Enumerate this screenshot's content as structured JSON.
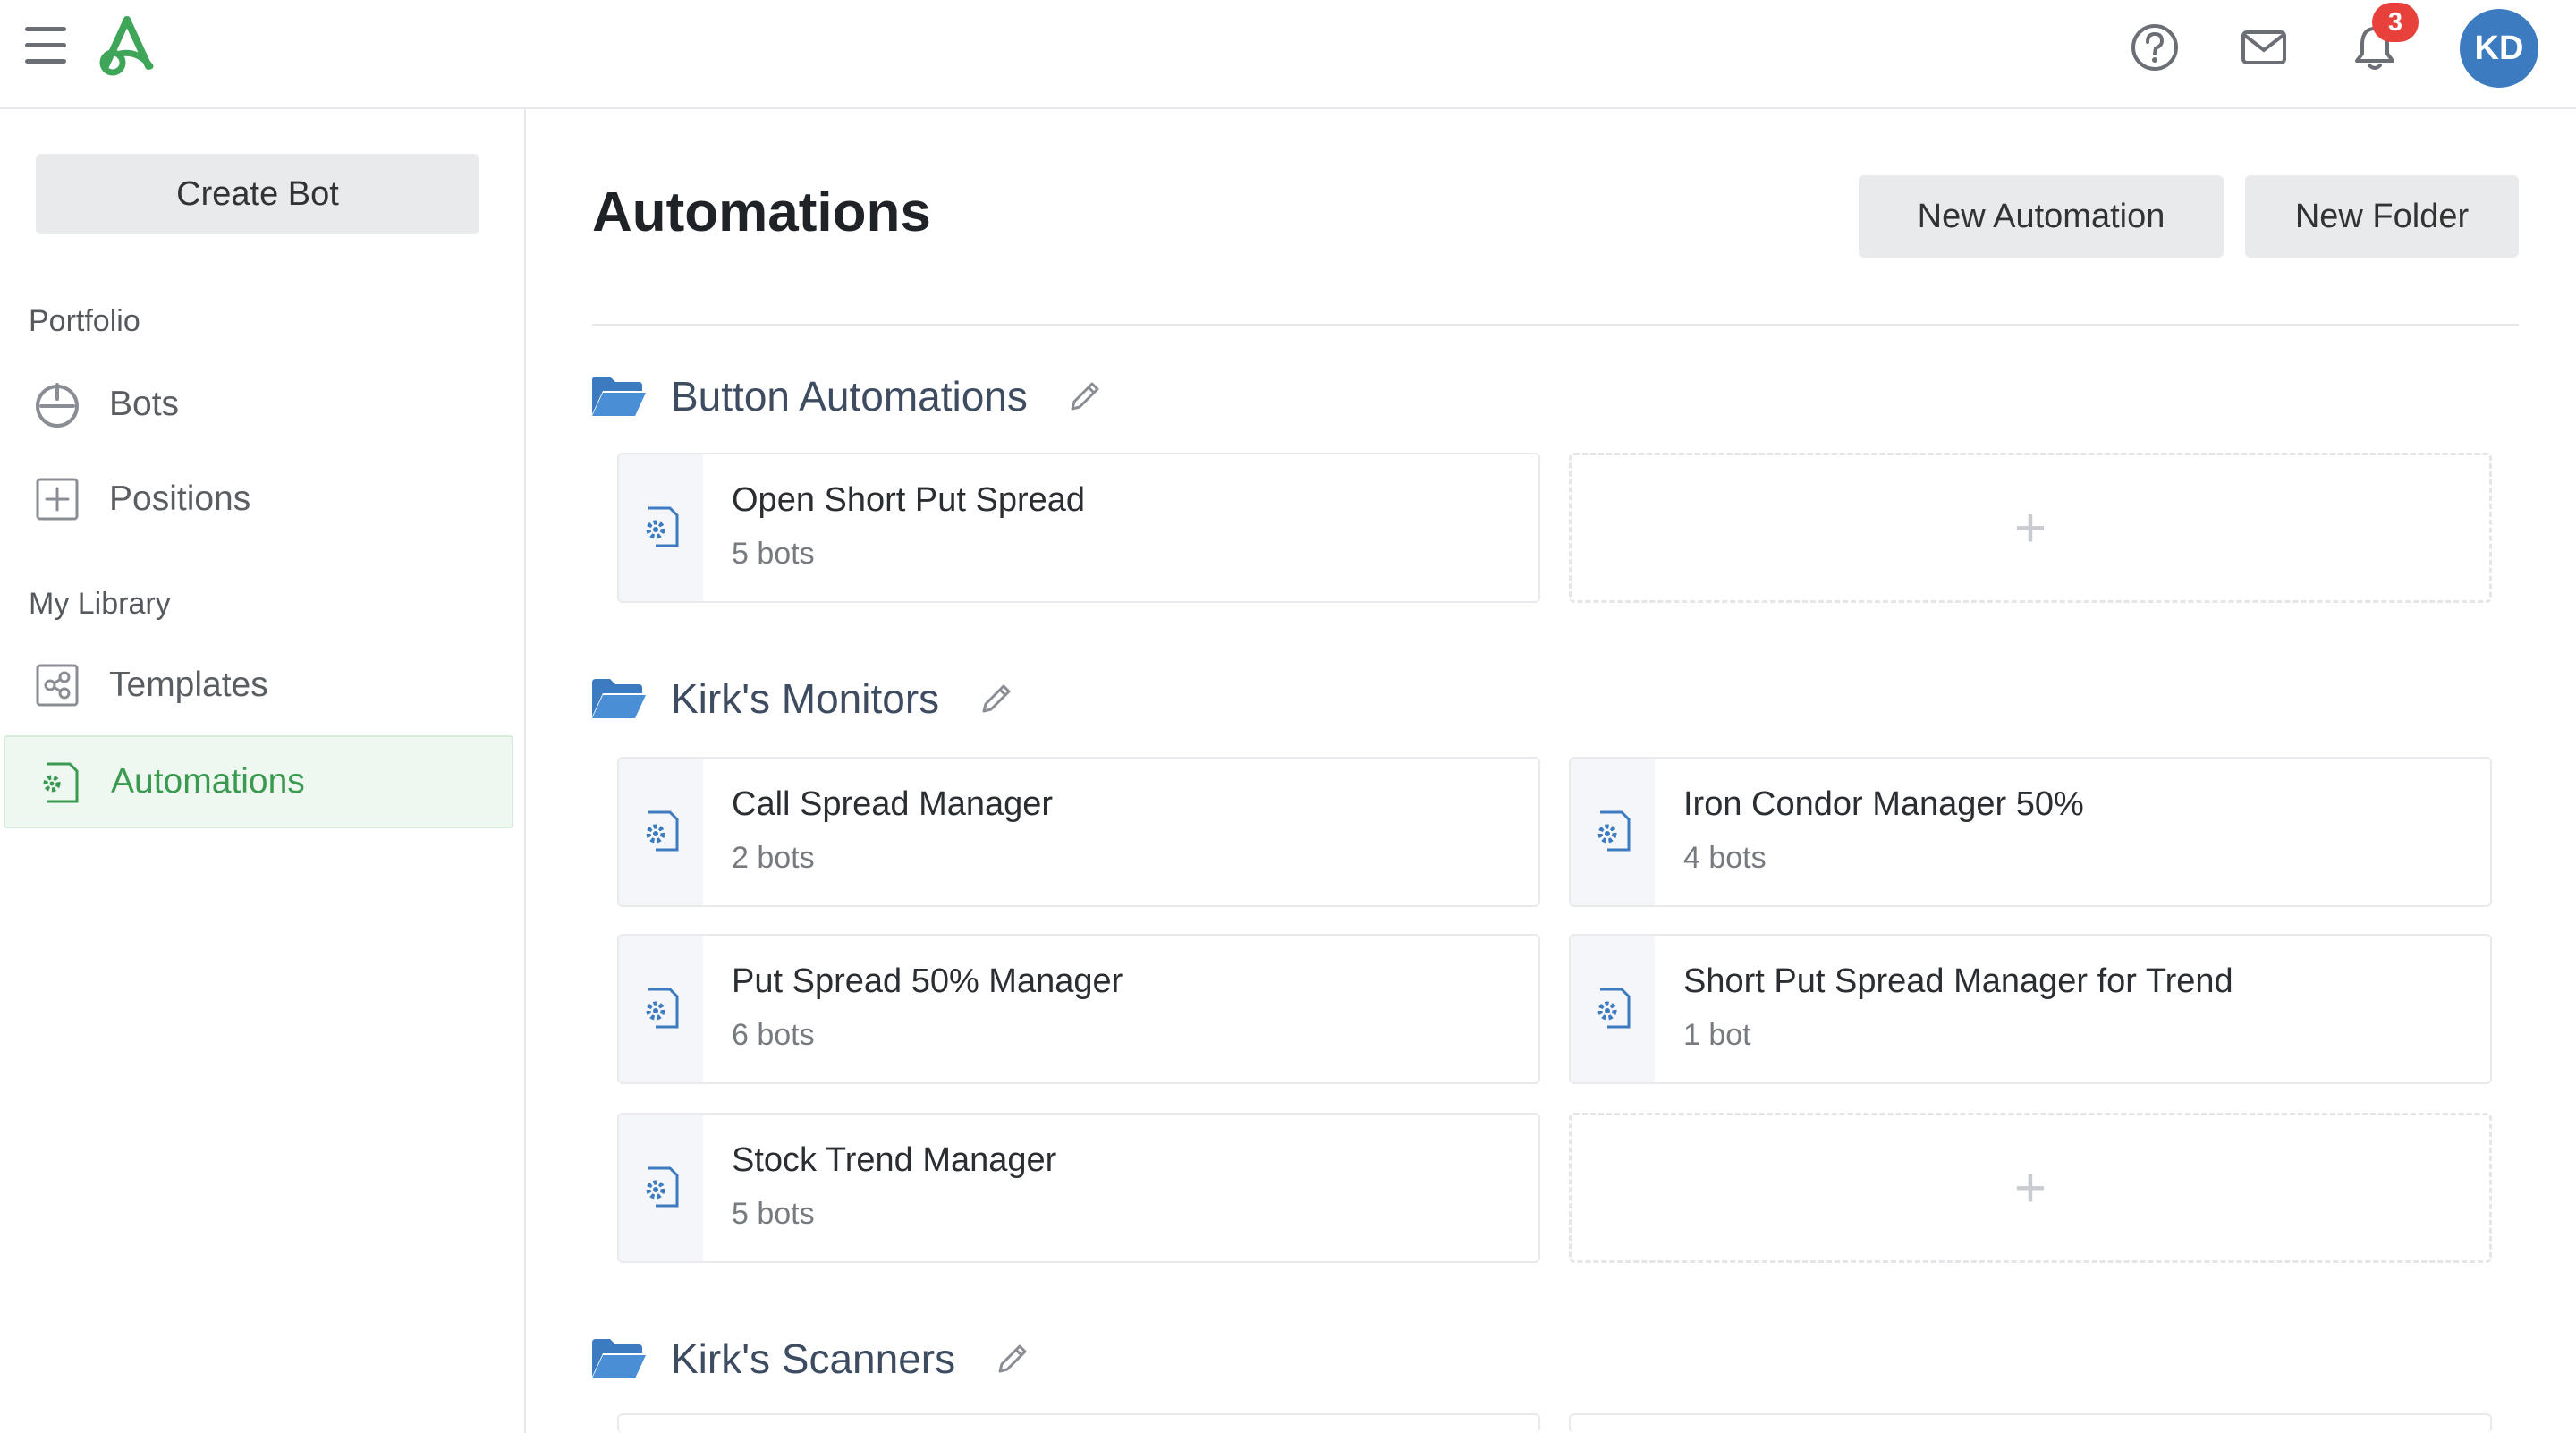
{
  "header": {
    "notification_count": "3",
    "avatar_initials": "KD"
  },
  "sidebar": {
    "create_bot_label": "Create Bot",
    "portfolio_label": "Portfolio",
    "my_library_label": "My Library",
    "items": [
      {
        "label": "Bots",
        "icon": "power-icon"
      },
      {
        "label": "Positions",
        "icon": "plus-square-icon"
      },
      {
        "label": "Templates",
        "icon": "share-icon"
      },
      {
        "label": "Automations",
        "icon": "gear-doc-icon",
        "active": true
      }
    ]
  },
  "main": {
    "title": "Automations",
    "new_automation_label": "New Automation",
    "new_folder_label": "New Folder",
    "add_symbol": "+",
    "folders": [
      {
        "name": "Button Automations",
        "automations": [
          {
            "title": "Open Short Put Spread",
            "subtitle": "5 bots"
          }
        ]
      },
      {
        "name": "Kirk's Monitors",
        "automations": [
          {
            "title": "Call Spread Manager",
            "subtitle": "2 bots"
          },
          {
            "title": "Iron Condor Manager 50%",
            "subtitle": "4 bots"
          },
          {
            "title": "Put Spread 50% Manager",
            "subtitle": "6 bots"
          },
          {
            "title": "Short Put Spread Manager for Trend",
            "subtitle": "1 bot"
          },
          {
            "title": "Stock Trend Manager",
            "subtitle": "5 bots"
          }
        ]
      },
      {
        "name": "Kirk's Scanners",
        "automations": []
      }
    ]
  },
  "colors": {
    "brand_green": "#3a9a4f",
    "icon_blue": "#3c7bc0",
    "badge_red": "#e8403a"
  }
}
